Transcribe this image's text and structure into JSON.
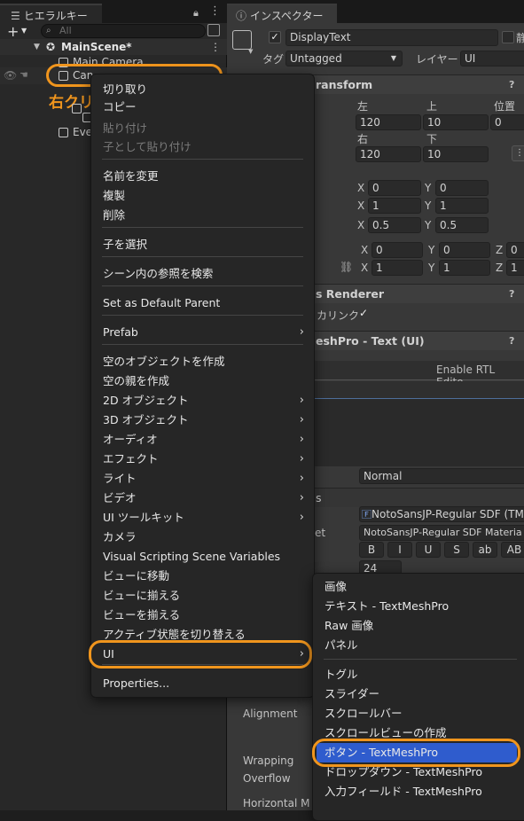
{
  "hierarchy": {
    "tab_label": "ヒエラルキー",
    "search_placeholder": "All",
    "scene_name": "MainScene*",
    "items": [
      "Main Camera",
      "Can",
      "Eve"
    ],
    "annotation": "右クリック"
  },
  "inspector": {
    "tab_label": "インスペクター",
    "object_name": "DisplayText",
    "tag_label": "タグ",
    "tag_value": "Untagged",
    "layer_label": "レイヤー",
    "layer_value": "UI",
    "rect_header": "ransform",
    "col_left": "左",
    "col_top": "上",
    "col_pos": "位置",
    "left": "120",
    "top": "10",
    "pos": "0",
    "col_right": "右",
    "col_bottom": "下",
    "right": "120",
    "bottom": "10",
    "x_label": "X",
    "y_label": "Y",
    "z_label": "Z",
    "anchor_min": [
      "0",
      "0"
    ],
    "anchor_max": [
      "1",
      "1"
    ],
    "pivot": [
      "0.5",
      "0.5"
    ],
    "rotation": [
      "0",
      "0",
      "0"
    ],
    "scale": [
      "1",
      "1",
      "1"
    ],
    "renderer_header": "s Renderer",
    "cull_label": "カリンク",
    "tmp_header": "eshPro - Text (UI)",
    "rtl_label": "Enable RTL Edito",
    "style_value": "Normal",
    "font_section": "s",
    "font_asset": "NotoSansJP-Regular SDF (TM",
    "material_label": "et",
    "material_value": "NotoSansJP-Regular SDF Materia",
    "font_style_buttons": [
      "B",
      "I",
      "U",
      "S",
      "ab",
      "AB"
    ],
    "font_size": "24",
    "alignment_label": "Alignment",
    "wrapping_label": "Wrapping",
    "overflow_label": "Overflow",
    "horizontal_label": "Horizontal M"
  },
  "context_menu": {
    "items": [
      {
        "label": "切り取り",
        "enabled": true
      },
      {
        "label": "コピー",
        "enabled": true
      },
      {
        "label": "貼り付け",
        "enabled": false
      },
      {
        "label": "子として貼り付け",
        "enabled": false
      },
      {
        "label": "名前を変更",
        "enabled": true
      },
      {
        "label": "複製",
        "enabled": true
      },
      {
        "label": "削除",
        "enabled": true
      },
      {
        "label": "子を選択",
        "enabled": true
      },
      {
        "label": "シーン内の参照を検索",
        "enabled": true
      },
      {
        "label": "Set as Default Parent",
        "enabled": true
      },
      {
        "label": "Prefab",
        "enabled": true
      },
      {
        "label": "空のオブジェクトを作成",
        "enabled": true
      },
      {
        "label": "空の親を作成",
        "enabled": true
      },
      {
        "label": "2D オブジェクト",
        "enabled": true
      },
      {
        "label": "3D オブジェクト",
        "enabled": true
      },
      {
        "label": "オーディオ",
        "enabled": true
      },
      {
        "label": "エフェクト",
        "enabled": true
      },
      {
        "label": "ライト",
        "enabled": true
      },
      {
        "label": "ビデオ",
        "enabled": true
      },
      {
        "label": "UI ツールキット",
        "enabled": true
      },
      {
        "label": "カメラ",
        "enabled": true
      },
      {
        "label": "Visual Scripting Scene Variables",
        "enabled": true
      },
      {
        "label": "ビューに移動",
        "enabled": true
      },
      {
        "label": "ビューに揃える",
        "enabled": true
      },
      {
        "label": "ビューを揃える",
        "enabled": true
      },
      {
        "label": "アクティブ状態を切り替える",
        "enabled": true
      },
      {
        "label": "UI",
        "enabled": true
      },
      {
        "label": "Properties...",
        "enabled": true
      }
    ]
  },
  "ui_submenu": {
    "items": [
      {
        "label": "画像"
      },
      {
        "label": "テキスト - TextMeshPro"
      },
      {
        "label": "Raw 画像"
      },
      {
        "label": "パネル"
      },
      {
        "label": "トグル"
      },
      {
        "label": "スライダー"
      },
      {
        "label": "スクロールバー"
      },
      {
        "label": "スクロールビューの作成"
      },
      {
        "label": "ボタン - TextMeshPro",
        "selected": true
      },
      {
        "label": "ドロップダウン - TextMeshPro"
      },
      {
        "label": "入力フィールド - TextMeshPro"
      }
    ]
  },
  "colors": {
    "accent_highlight": "#f0951d",
    "selection_blue": "#2f5ccd"
  }
}
